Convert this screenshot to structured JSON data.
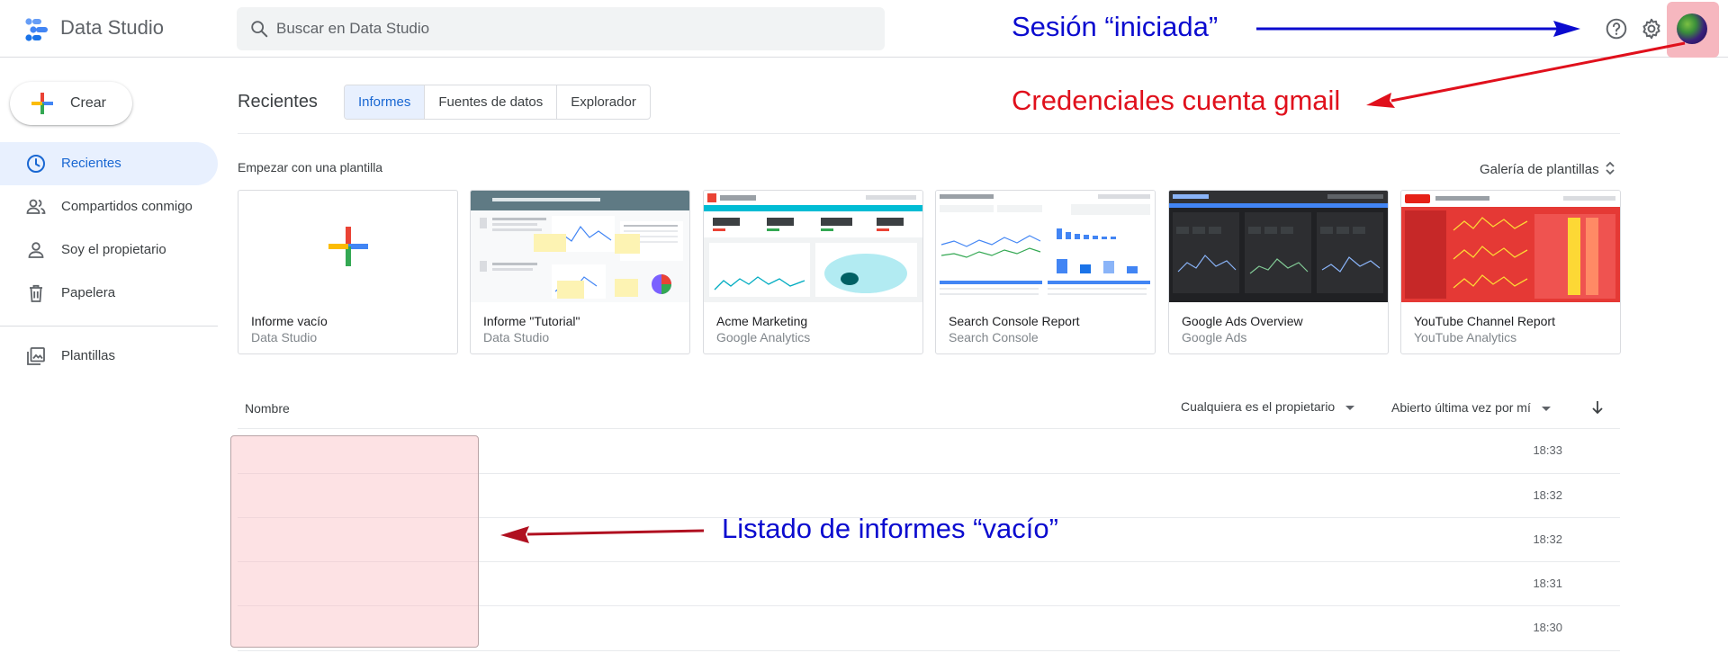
{
  "header": {
    "app_title": "Data Studio",
    "search_placeholder": "Buscar en Data Studio"
  },
  "annotations": {
    "session": "Sesión “iniciada”",
    "credentials": "Credenciales cuenta gmail",
    "empty_list": "Listado de informes “vacío”"
  },
  "sidebar": {
    "create_label": "Crear",
    "items": [
      {
        "label": "Recientes",
        "icon": "clock-icon"
      },
      {
        "label": "Compartidos conmigo",
        "icon": "people-icon"
      },
      {
        "label": "Soy el propietario",
        "icon": "person-icon"
      },
      {
        "label": "Papelera",
        "icon": "trash-icon"
      },
      {
        "label": "Plantillas",
        "icon": "templates-icon"
      }
    ]
  },
  "main": {
    "section_title": "Recientes",
    "tabs": [
      {
        "label": "Informes"
      },
      {
        "label": "Fuentes de datos"
      },
      {
        "label": "Explorador"
      }
    ],
    "templates_heading": "Empezar con una plantilla",
    "gallery_label": "Galería de plantillas",
    "templates": [
      {
        "title": "Informe vacío",
        "subtitle": "Data Studio"
      },
      {
        "title": "Informe \"Tutorial\"",
        "subtitle": "Data Studio"
      },
      {
        "title": "Acme Marketing",
        "subtitle": "Google Analytics"
      },
      {
        "title": "Search Console Report",
        "subtitle": "Search Console"
      },
      {
        "title": "Google Ads Overview",
        "subtitle": "Google Ads"
      },
      {
        "title": "YouTube Channel Report",
        "subtitle": "YouTube Analytics"
      }
    ]
  },
  "list": {
    "name_header": "Nombre",
    "owner_filter": "Cualquiera es el propietario",
    "sort_filter": "Abierto última vez por mí",
    "rows": [
      {
        "time": "18:33"
      },
      {
        "time": "18:32"
      },
      {
        "time": "18:32"
      },
      {
        "time": "18:31"
      },
      {
        "time": "18:30"
      }
    ]
  },
  "colors": {
    "accent": "#1967d2",
    "active_bg": "#e8f0fe",
    "annotation_blue": "#0b0bcf",
    "annotation_red": "#e0101c"
  }
}
